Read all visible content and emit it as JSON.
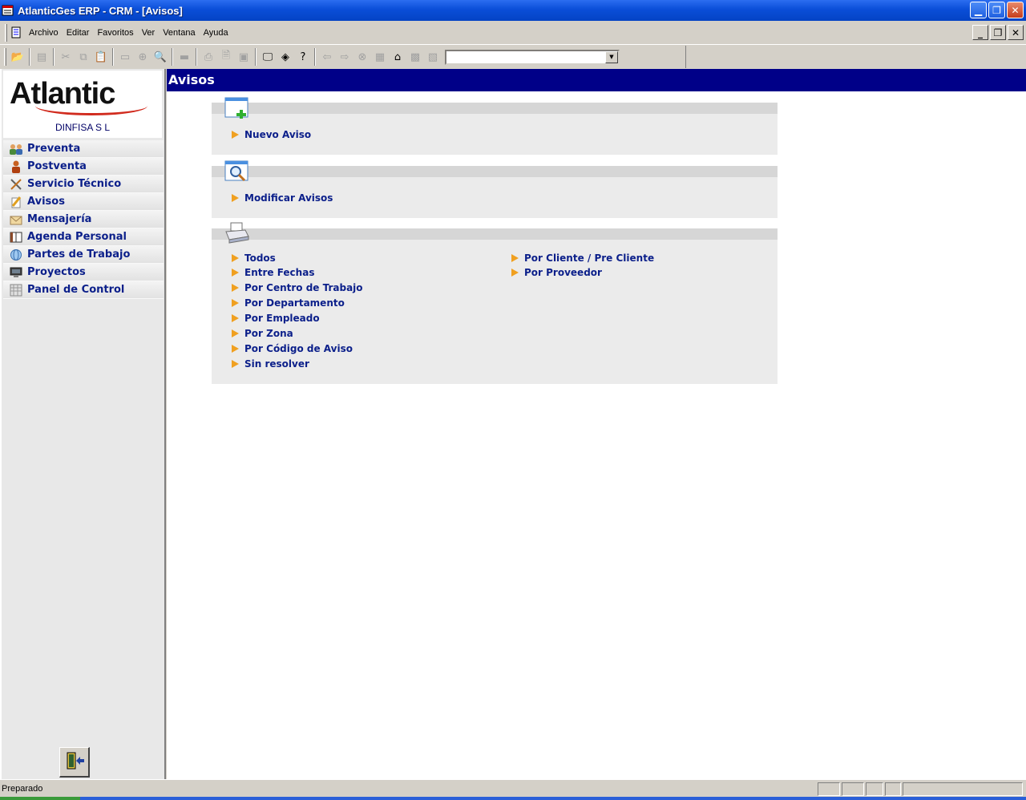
{
  "window": {
    "title": "AtlanticGes ERP - CRM - [Avisos]"
  },
  "menu": [
    {
      "label": "Archivo"
    },
    {
      "label": "Editar"
    },
    {
      "label": "Favoritos"
    },
    {
      "label": "Ver"
    },
    {
      "label": "Ventana"
    },
    {
      "label": "Ayuda"
    }
  ],
  "toolbar": {
    "combo_value": ""
  },
  "sidebar": {
    "logo_text": "Atlantic",
    "company": "DINFISA  S L",
    "items": [
      {
        "label": "Preventa",
        "icon": "people-icon"
      },
      {
        "label": "Postventa",
        "icon": "person-icon"
      },
      {
        "label": "Servicio Técnico",
        "icon": "tools-icon"
      },
      {
        "label": "Avisos",
        "icon": "pencil-icon"
      },
      {
        "label": "Mensajería",
        "icon": "envelope-icon"
      },
      {
        "label": "Agenda Personal",
        "icon": "book-icon"
      },
      {
        "label": "Partes de Trabajo",
        "icon": "globe-icon"
      },
      {
        "label": "Proyectos",
        "icon": "monitor-icon"
      },
      {
        "label": "Panel de Control",
        "icon": "calendar-grid-icon"
      }
    ]
  },
  "main": {
    "title": "Avisos",
    "sections": [
      {
        "icon": "new-window-icon",
        "links": [
          "Nuevo Aviso"
        ]
      },
      {
        "icon": "magnifier-window-icon",
        "links": [
          "Modificar Avisos"
        ]
      },
      {
        "icon": "printer-icon",
        "links_left": [
          "Todos",
          "Entre Fechas",
          "Por Centro de Trabajo",
          "Por Departamento",
          "Por Empleado",
          "Por Zona",
          "Por Código de Aviso",
          "Sin resolver"
        ],
        "links_right": [
          "Por Cliente / Pre Cliente",
          "Por Proveedor"
        ]
      }
    ]
  },
  "status": {
    "text": "Preparado"
  },
  "colors": {
    "header_bg": "#000088",
    "link": "#0b1f8a",
    "bullet": "#f0a020"
  }
}
